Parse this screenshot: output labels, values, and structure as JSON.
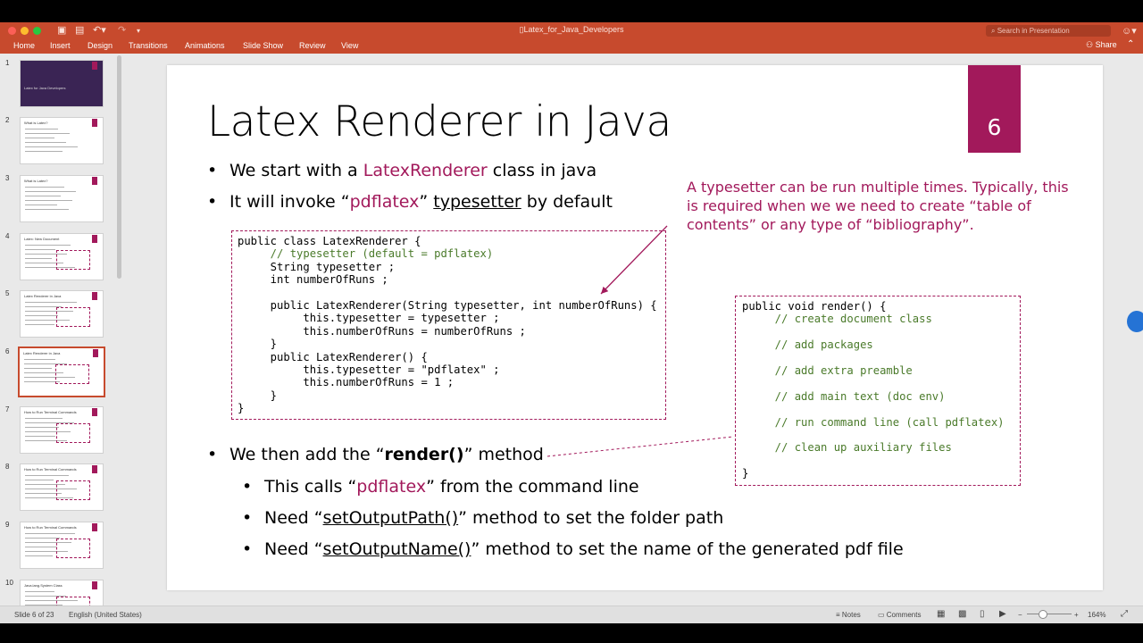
{
  "window": {
    "doc_title": "Latex_for_Java_Developers",
    "search_placeholder": "Search in Presentation",
    "share_label": "Share"
  },
  "ribbon_tabs": [
    "Home",
    "Insert",
    "Design",
    "Transitions",
    "Animations",
    "Slide Show",
    "Review",
    "View"
  ],
  "thumbnails": [
    {
      "num": "1",
      "title": "Latex for Java Developers"
    },
    {
      "num": "2",
      "title": "What is Latex?"
    },
    {
      "num": "3",
      "title": "What is Latex?"
    },
    {
      "num": "4",
      "title": "Latex: New Document"
    },
    {
      "num": "5",
      "title": "Latex Renderer in Java"
    },
    {
      "num": "6",
      "title": "Latex Renderer in Java"
    },
    {
      "num": "7",
      "title": "How to Run Terminal Commands"
    },
    {
      "num": "8",
      "title": "How to Run Terminal Commands"
    },
    {
      "num": "9",
      "title": "How to Run Terminal Commands"
    },
    {
      "num": "10",
      "title": "Java.lang.System Class"
    }
  ],
  "slide": {
    "title": "Latex Renderer in Java",
    "number": "6",
    "bullet1": {
      "pre": "We start with a ",
      "hl": "LatexRenderer",
      "post": " class in java"
    },
    "bullet2": {
      "pre": "It will invoke “",
      "hl": "pdflatex",
      "mid": "” ",
      "u": "typesetter",
      "post": " by default"
    },
    "note": "A typesetter can be run multiple times. Typically, this is required when we we need to create “table of contents” or any type of “bibliography”.",
    "bullet3": {
      "pre": "We then add the “",
      "bold": "render()",
      "post": "” method"
    },
    "sub1": {
      "pre": "This calls “",
      "hl": "pdflatex",
      "post": "” from the command line"
    },
    "sub2": {
      "pre": "Need “",
      "u": "setOutputPath()",
      "post": "” method to set the folder path"
    },
    "sub3": {
      "pre": "Need “",
      "u": "setOutputName()",
      "post": "” method to set the name of the generated pdf file"
    },
    "code_class": [
      "public class LatexRenderer {",
      "     // typesetter (default = pdflatex)",
      "     String typesetter ;",
      "     int numberOfRuns ;",
      "",
      "     public LatexRenderer(String typesetter, int numberOfRuns) {",
      "          this.typesetter = typesetter ;",
      "          this.numberOfRuns = numberOfRuns ;",
      "     }",
      "     public LatexRenderer() {",
      "          this.typesetter = \"pdflatex\" ;",
      "          this.numberOfRuns = 1 ;",
      "     }",
      "}"
    ],
    "code_render": [
      "public void render() {",
      "     // create document class",
      "",
      "     // add packages",
      "",
      "     // add extra preamble",
      "",
      "     // add main text (doc env)",
      "",
      "     // run command line (call pdflatex)",
      "",
      "     // clean up auxiliary files",
      "",
      "}"
    ]
  },
  "status": {
    "slide_info": "Slide 6 of 23",
    "language": "English (United States)",
    "notes_label": "Notes",
    "comments_label": "Comments",
    "zoom": "164%"
  },
  "colors": {
    "ribbon": "#c74a2d",
    "accent": "#a2195b"
  }
}
